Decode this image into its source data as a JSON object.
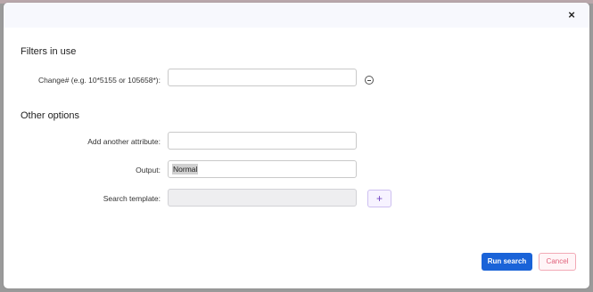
{
  "dialog": {
    "close_glyph": "×"
  },
  "filters_section": {
    "title": "Filters in use",
    "change_label": "Change# (e.g. 10*5155 or 105658*):",
    "change_value": ""
  },
  "options_section": {
    "title": "Other options",
    "attribute_label": "Add another attribute:",
    "attribute_value": "",
    "output_label": "Output:",
    "output_value": "Normal",
    "template_label": "Search template:",
    "template_value": "",
    "add_glyph": "+"
  },
  "footer": {
    "run_label": "Run search",
    "cancel_label": "Cancel"
  },
  "colors": {
    "primary": "#1a63d8",
    "cancel_text": "#e0607a",
    "add_accent": "#6f42c1"
  }
}
